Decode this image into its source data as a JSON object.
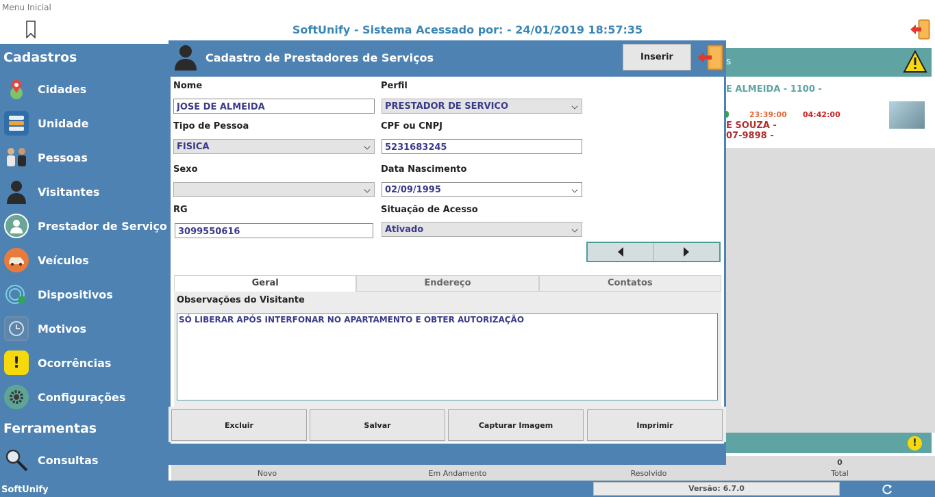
{
  "top": {
    "menu_label": "Menu Inicial",
    "title": "SoftUnify - Sistema Acessado por:  -  24/01/2019 18:57:35"
  },
  "sidebar": {
    "section_cadastros": "Cadastros",
    "items": [
      {
        "label": "Cidades",
        "icon": "map-pin-icon"
      },
      {
        "label": "Unidade",
        "icon": "unit-icon"
      },
      {
        "label": "Pessoas",
        "icon": "people-icon"
      },
      {
        "label": "Visitantes",
        "icon": "visitor-icon"
      },
      {
        "label": "Prestador de Serviço",
        "icon": "service-provider-icon"
      },
      {
        "label": "Veículos",
        "icon": "car-icon"
      },
      {
        "label": "Dispositivos",
        "icon": "device-icon"
      },
      {
        "label": "Motivos",
        "icon": "clock-icon"
      },
      {
        "label": "Ocorrências",
        "icon": "exclamation-icon"
      },
      {
        "label": "Configurações",
        "icon": "gear-icon"
      }
    ],
    "section_ferramentas": "Ferramentas",
    "tools": [
      {
        "label": "Consultas",
        "icon": "search-icon"
      }
    ],
    "footer": "SoftUnify"
  },
  "background": {
    "panel_header_fragment": "s",
    "card_name": "E ALMEIDA  - 1100 -",
    "card_time1": "23:39:00",
    "card_time2": "04:42:00",
    "card_line3": "E SOUZA -",
    "card_line4": "07-9898 -",
    "alert_symbol": "!",
    "stats": [
      {
        "value": "",
        "label": "Novo"
      },
      {
        "value": "",
        "label": "Em Andamento"
      },
      {
        "value": "",
        "label": "Resolvido"
      },
      {
        "value": "0",
        "label": "Total"
      }
    ],
    "version": "Versão: 6.7.0"
  },
  "dialog": {
    "title": "Cadastro de Prestadores de Serviços",
    "insert_label": "Inserir",
    "fields": {
      "nome_label": "Nome",
      "nome_value": "JOSE DE ALMEIDA",
      "perfil_label": "Perfil",
      "perfil_value": "PRESTADOR DE SERVICO",
      "tipo_label": "Tipo de Pessoa",
      "tipo_value": "FISICA",
      "cpf_label": "CPF ou CNPJ",
      "cpf_value": "5231683245",
      "sexo_label": "Sexo",
      "sexo_value": "",
      "nasc_label": "Data Nascimento",
      "nasc_value": "02/09/1995",
      "rg_label": "RG",
      "rg_value": "3099550616",
      "situacao_label": "Situação de Acesso",
      "situacao_value": "Ativado"
    },
    "tabs": [
      "Geral",
      "Endereço",
      "Contatos"
    ],
    "active_tab": "Geral",
    "obs_label": "Observações do Visitante",
    "obs_value": "SÓ LIBERAR APÓS INTERFONAR NO APARTAMENTO E OBTER AUTORIZAÇÃO",
    "actions": {
      "delete": "Excluir",
      "save": "Salvar",
      "capture": "Capturar Imagem",
      "print": "Imprimir"
    }
  },
  "colors": {
    "sidebar": "#4d82b2",
    "teal": "#5fa3a3",
    "title_blue": "#3a87b6",
    "value_text": "#3a3a8a"
  }
}
